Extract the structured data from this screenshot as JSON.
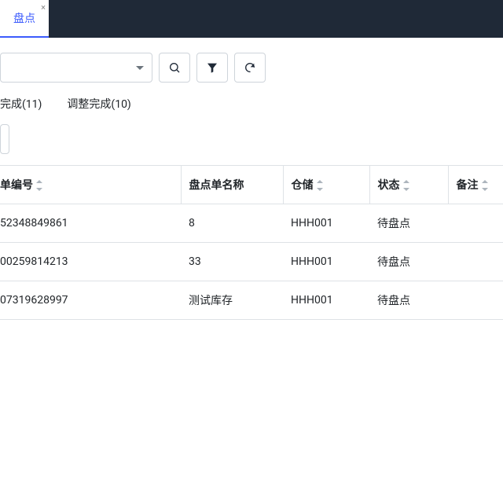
{
  "tab": {
    "label": "盘点",
    "close": "×"
  },
  "filter_tabs": {
    "tab1": "完成(11)",
    "tab2": "调整完成(10)"
  },
  "table": {
    "headers": {
      "num": "单编号",
      "name": "盘点单名称",
      "storage": "仓储",
      "status": "状态",
      "remark": "备注"
    },
    "rows": [
      {
        "num": "52348849861",
        "name": "8",
        "storage": "HHH001",
        "status": "待盘点",
        "remark": ""
      },
      {
        "num": "00259814213",
        "name": "33",
        "storage": "HHH001",
        "status": "待盘点",
        "remark": ""
      },
      {
        "num": "07319628997",
        "name": "测试库存",
        "storage": "HHH001",
        "status": "待盘点",
        "remark": ""
      }
    ]
  }
}
